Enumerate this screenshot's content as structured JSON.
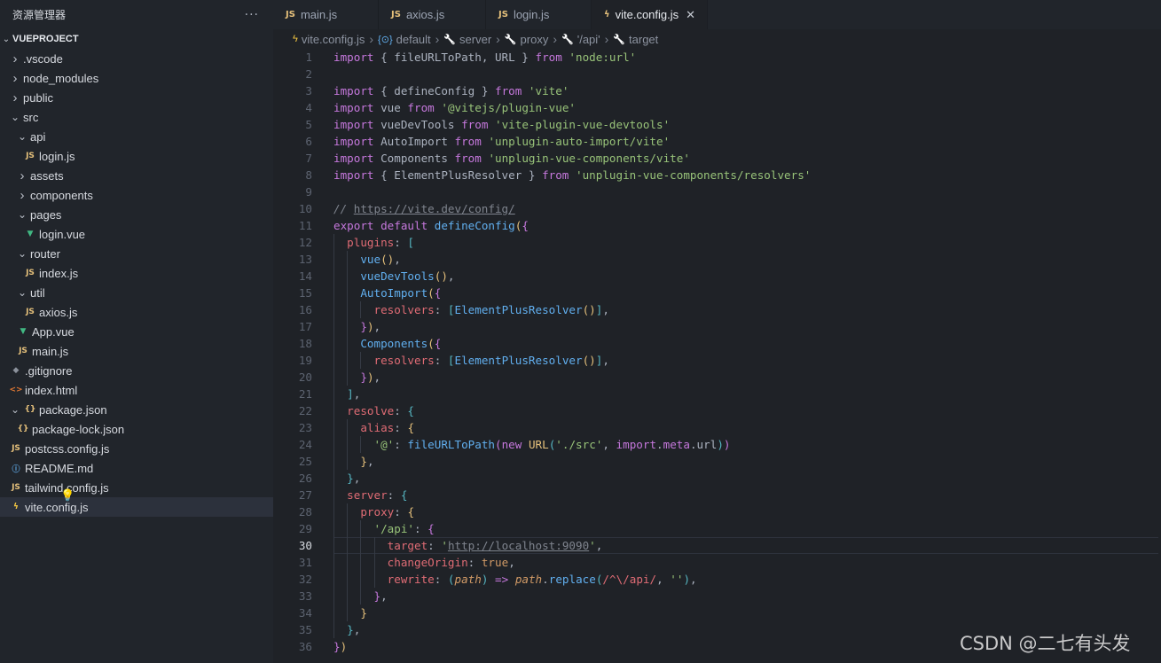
{
  "sidebar": {
    "title": "资源管理器",
    "more": "···",
    "project": "VUEPROJECT",
    "items": [
      {
        "label": ".vscode",
        "indent": 0,
        "kind": "folder",
        "open": false
      },
      {
        "label": "node_modules",
        "indent": 0,
        "kind": "folder",
        "open": false
      },
      {
        "label": "public",
        "indent": 0,
        "kind": "folder",
        "open": false
      },
      {
        "label": "src",
        "indent": 0,
        "kind": "folder",
        "open": true
      },
      {
        "label": "api",
        "indent": 1,
        "kind": "folder",
        "open": true
      },
      {
        "label": "login.js",
        "indent": 2,
        "kind": "js"
      },
      {
        "label": "assets",
        "indent": 1,
        "kind": "folder",
        "open": false
      },
      {
        "label": "components",
        "indent": 1,
        "kind": "folder",
        "open": false
      },
      {
        "label": "pages",
        "indent": 1,
        "kind": "folder",
        "open": true
      },
      {
        "label": "login.vue",
        "indent": 2,
        "kind": "vue"
      },
      {
        "label": "router",
        "indent": 1,
        "kind": "folder",
        "open": true
      },
      {
        "label": "index.js",
        "indent": 2,
        "kind": "js"
      },
      {
        "label": "util",
        "indent": 1,
        "kind": "folder",
        "open": true
      },
      {
        "label": "axios.js",
        "indent": 2,
        "kind": "js"
      },
      {
        "label": "App.vue",
        "indent": 1,
        "kind": "vue"
      },
      {
        "label": "main.js",
        "indent": 1,
        "kind": "js"
      },
      {
        "label": ".gitignore",
        "indent": 0,
        "kind": "git"
      },
      {
        "label": "index.html",
        "indent": 0,
        "kind": "html"
      },
      {
        "label": "package.json",
        "indent": 0,
        "kind": "folder-json",
        "open": true
      },
      {
        "label": "package-lock.json",
        "indent": 1,
        "kind": "json"
      },
      {
        "label": "postcss.config.js",
        "indent": 0,
        "kind": "js"
      },
      {
        "label": "README.md",
        "indent": 0,
        "kind": "info"
      },
      {
        "label": "tailwind.config.js",
        "indent": 0,
        "kind": "js"
      },
      {
        "label": "vite.config.js",
        "indent": 0,
        "kind": "vite",
        "selected": true
      }
    ]
  },
  "tabs": [
    {
      "label": "main.js",
      "icon": "JS",
      "active": false
    },
    {
      "label": "axios.js",
      "icon": "JS",
      "active": false
    },
    {
      "label": "login.js",
      "icon": "JS",
      "active": false
    },
    {
      "label": "vite.config.js",
      "icon": "vite",
      "active": true,
      "close": "✕"
    }
  ],
  "breadcrumb": [
    {
      "label": "vite.config.js",
      "icon": "vite"
    },
    {
      "label": "default",
      "icon": "module"
    },
    {
      "label": "server",
      "icon": "wrench"
    },
    {
      "label": "proxy",
      "icon": "wrench"
    },
    {
      "label": "'/api'",
      "icon": "wrench"
    },
    {
      "label": "target",
      "icon": "wrench"
    }
  ],
  "editor": {
    "current_line": 30,
    "lines": [
      [
        [
          "kw",
          "import"
        ],
        [
          "p",
          " { fileURLToPath, URL } "
        ],
        [
          "kw",
          "from"
        ],
        [
          "p",
          " "
        ],
        [
          "str",
          "'node:url'"
        ]
      ],
      [],
      [
        [
          "kw",
          "import"
        ],
        [
          "p",
          " { defineConfig } "
        ],
        [
          "kw",
          "from"
        ],
        [
          "p",
          " "
        ],
        [
          "str",
          "'vite'"
        ]
      ],
      [
        [
          "kw",
          "import"
        ],
        [
          "p",
          " vue "
        ],
        [
          "kw",
          "from"
        ],
        [
          "p",
          " "
        ],
        [
          "str",
          "'@vitejs/plugin-vue'"
        ]
      ],
      [
        [
          "kw",
          "import"
        ],
        [
          "p",
          " vueDevTools "
        ],
        [
          "kw",
          "from"
        ],
        [
          "p",
          " "
        ],
        [
          "str",
          "'vite-plugin-vue-devtools'"
        ]
      ],
      [
        [
          "kw",
          "import"
        ],
        [
          "p",
          " AutoImport "
        ],
        [
          "kw",
          "from"
        ],
        [
          "p",
          " "
        ],
        [
          "str",
          "'unplugin-auto-import/vite'"
        ]
      ],
      [
        [
          "kw",
          "import"
        ],
        [
          "p",
          " Components "
        ],
        [
          "kw",
          "from"
        ],
        [
          "p",
          " "
        ],
        [
          "str",
          "'unplugin-vue-components/vite'"
        ]
      ],
      [
        [
          "kw",
          "import"
        ],
        [
          "p",
          " { ElementPlusResolver } "
        ],
        [
          "kw",
          "from"
        ],
        [
          "p",
          " "
        ],
        [
          "str",
          "'unplugin-vue-components/resolvers'"
        ]
      ],
      [],
      [
        [
          "cm",
          "// "
        ],
        [
          "link",
          "https://vite.dev/config/"
        ]
      ],
      [
        [
          "kw",
          "export"
        ],
        [
          "p",
          " "
        ],
        [
          "kw",
          "default"
        ],
        [
          "p",
          " "
        ],
        [
          "fn",
          "defineConfig"
        ],
        [
          "br1",
          "("
        ],
        [
          "br2",
          "{"
        ]
      ],
      [
        [
          "p",
          "  "
        ],
        [
          "prop",
          "plugins"
        ],
        [
          "p",
          ": "
        ],
        [
          "br3",
          "["
        ]
      ],
      [
        [
          "p",
          "    "
        ],
        [
          "fn",
          "vue"
        ],
        [
          "br1",
          "()"
        ],
        [
          "p",
          ","
        ]
      ],
      [
        [
          "p",
          "    "
        ],
        [
          "fn",
          "vueDevTools"
        ],
        [
          "br1",
          "()"
        ],
        [
          "p",
          ","
        ]
      ],
      [
        [
          "p",
          "    "
        ],
        [
          "fn",
          "AutoImport"
        ],
        [
          "br1",
          "("
        ],
        [
          "br2",
          "{"
        ]
      ],
      [
        [
          "p",
          "      "
        ],
        [
          "prop",
          "resolvers"
        ],
        [
          "p",
          ": "
        ],
        [
          "br3",
          "["
        ],
        [
          "fn",
          "ElementPlusResolver"
        ],
        [
          "br1",
          "()"
        ],
        [
          "br3",
          "]"
        ],
        [
          "p",
          ","
        ]
      ],
      [
        [
          "p",
          "    "
        ],
        [
          "br2",
          "}"
        ],
        [
          "br1",
          ")"
        ],
        [
          "p",
          ","
        ]
      ],
      [
        [
          "p",
          "    "
        ],
        [
          "fn",
          "Components"
        ],
        [
          "br1",
          "("
        ],
        [
          "br2",
          "{"
        ]
      ],
      [
        [
          "p",
          "      "
        ],
        [
          "prop",
          "resolvers"
        ],
        [
          "p",
          ": "
        ],
        [
          "br3",
          "["
        ],
        [
          "fn",
          "ElementPlusResolver"
        ],
        [
          "br1",
          "()"
        ],
        [
          "br3",
          "]"
        ],
        [
          "p",
          ","
        ]
      ],
      [
        [
          "p",
          "    "
        ],
        [
          "br2",
          "}"
        ],
        [
          "br1",
          ")"
        ],
        [
          "p",
          ","
        ]
      ],
      [
        [
          "p",
          "  "
        ],
        [
          "br3",
          "]"
        ],
        [
          "p",
          ","
        ]
      ],
      [
        [
          "p",
          "  "
        ],
        [
          "prop",
          "resolve"
        ],
        [
          "p",
          ": "
        ],
        [
          "br3",
          "{"
        ]
      ],
      [
        [
          "p",
          "    "
        ],
        [
          "prop",
          "alias"
        ],
        [
          "p",
          ": "
        ],
        [
          "br1",
          "{"
        ]
      ],
      [
        [
          "p",
          "      "
        ],
        [
          "str",
          "'@'"
        ],
        [
          "p",
          ": "
        ],
        [
          "fn",
          "fileURLToPath"
        ],
        [
          "br2",
          "("
        ],
        [
          "kw",
          "new"
        ],
        [
          "p",
          " "
        ],
        [
          "cls",
          "URL"
        ],
        [
          "br3",
          "("
        ],
        [
          "str",
          "'./src'"
        ],
        [
          "p",
          ", "
        ],
        [
          "kw",
          "import"
        ],
        [
          "p",
          "."
        ],
        [
          "kw",
          "meta"
        ],
        [
          "p",
          ".url"
        ],
        [
          "br3",
          ")"
        ],
        [
          "br2",
          ")"
        ]
      ],
      [
        [
          "p",
          "    "
        ],
        [
          "br1",
          "}"
        ],
        [
          "p",
          ","
        ]
      ],
      [
        [
          "p",
          "  "
        ],
        [
          "br3",
          "}"
        ],
        [
          "p",
          ","
        ]
      ],
      [
        [
          "p",
          "  "
        ],
        [
          "prop",
          "server"
        ],
        [
          "p",
          ": "
        ],
        [
          "br3",
          "{"
        ]
      ],
      [
        [
          "p",
          "    "
        ],
        [
          "prop",
          "proxy"
        ],
        [
          "p",
          ": "
        ],
        [
          "br1",
          "{"
        ]
      ],
      [
        [
          "p",
          "      "
        ],
        [
          "str",
          "'/api'"
        ],
        [
          "p",
          ": "
        ],
        [
          "br2",
          "{"
        ]
      ],
      [
        [
          "p",
          "        "
        ],
        [
          "prop",
          "target"
        ],
        [
          "p",
          ": "
        ],
        [
          "str",
          "'"
        ],
        [
          "link",
          "http://localhost:9090"
        ],
        [
          "str",
          "'"
        ],
        [
          "p",
          ","
        ]
      ],
      [
        [
          "p",
          "        "
        ],
        [
          "prop",
          "changeOrigin"
        ],
        [
          "p",
          ": "
        ],
        [
          "num",
          "true"
        ],
        [
          "p",
          ","
        ]
      ],
      [
        [
          "p",
          "        "
        ],
        [
          "prop",
          "rewrite"
        ],
        [
          "p",
          ": "
        ],
        [
          "br3",
          "("
        ],
        [
          "param",
          "path"
        ],
        [
          "br3",
          ")"
        ],
        [
          "p",
          " "
        ],
        [
          "kw",
          "=>"
        ],
        [
          "p",
          " "
        ],
        [
          "param",
          "path"
        ],
        [
          "p",
          "."
        ],
        [
          "fn",
          "replace"
        ],
        [
          "br3",
          "("
        ],
        [
          "prop",
          "/^\\/api/"
        ],
        [
          "p",
          ", "
        ],
        [
          "str",
          "''"
        ],
        [
          "br3",
          ")"
        ],
        [
          "p",
          ","
        ]
      ],
      [
        [
          "p",
          "      "
        ],
        [
          "br2",
          "}"
        ],
        [
          "p",
          ","
        ]
      ],
      [
        [
          "p",
          "    "
        ],
        [
          "br1",
          "}"
        ]
      ],
      [
        [
          "p",
          "  "
        ],
        [
          "br3",
          "}"
        ],
        [
          "p",
          ","
        ]
      ],
      [
        [
          "br2",
          "}"
        ],
        [
          "br1",
          ")"
        ]
      ]
    ]
  },
  "watermark": "CSDN @二七有头发"
}
